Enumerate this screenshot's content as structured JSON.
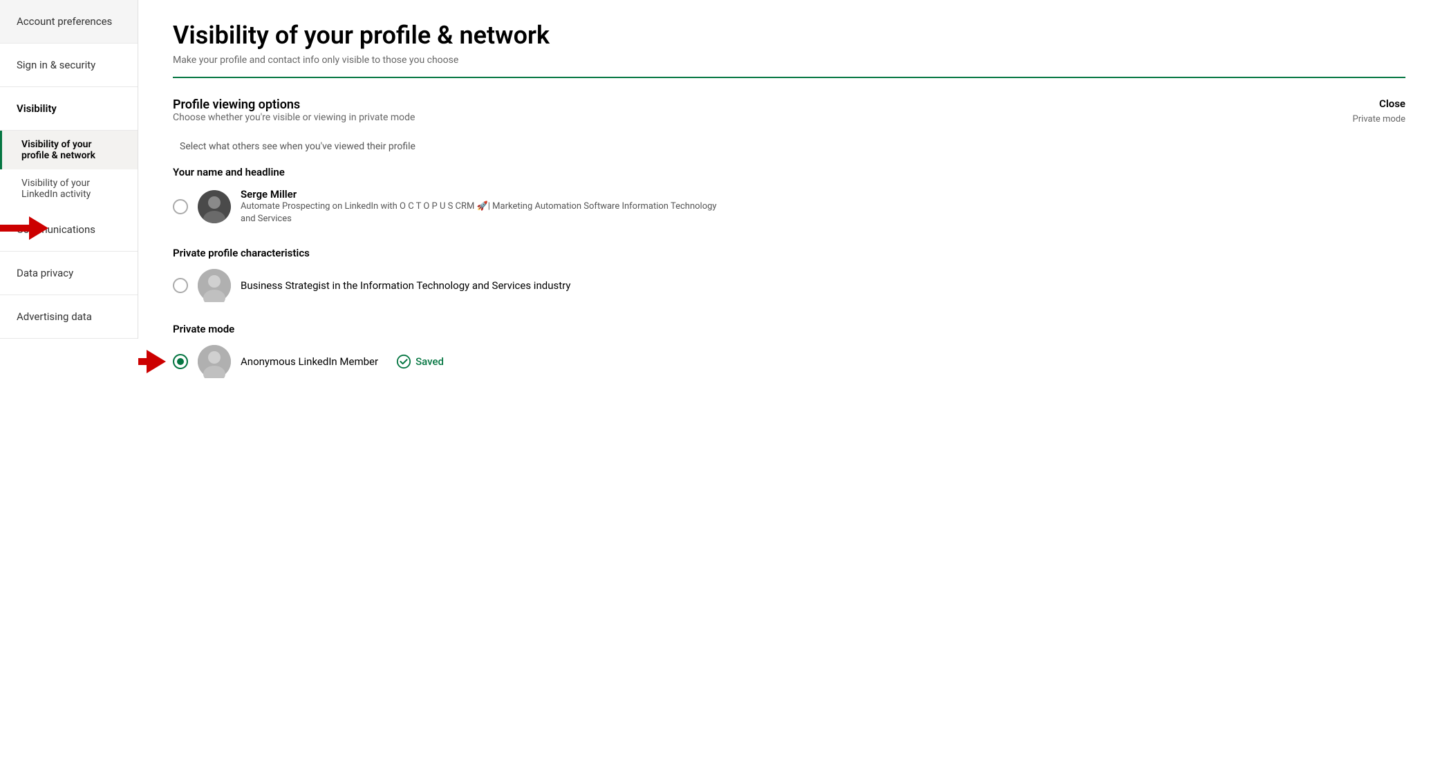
{
  "sidebar": {
    "items": [
      {
        "id": "account-preferences",
        "label": "Account preferences",
        "active": false
      },
      {
        "id": "sign-in-security",
        "label": "Sign in & security",
        "active": false
      },
      {
        "id": "visibility",
        "label": "Visibility",
        "active": true,
        "subitems": [
          {
            "id": "visibility-profile-network",
            "label": "Visibility of your profile & network",
            "active": true
          },
          {
            "id": "visibility-linkedin-activity",
            "label": "Visibility of your LinkedIn activity",
            "active": false
          }
        ]
      },
      {
        "id": "communications",
        "label": "Communications",
        "active": false
      },
      {
        "id": "data-privacy",
        "label": "Data privacy",
        "active": false
      },
      {
        "id": "advertising-data",
        "label": "Advertising data",
        "active": false
      }
    ]
  },
  "main": {
    "page_title": "Visibility of your profile & network",
    "page_subtitle": "Make your profile and contact info only visible to those you choose",
    "section_title": "Profile viewing options",
    "section_subtitle": "Choose whether you're visible or viewing in private mode",
    "select_hint": "Select what others see when you've viewed their profile",
    "close_label": "Close",
    "close_subtext": "Private mode",
    "options": [
      {
        "id": "your-name",
        "group_label": "Your name and headline",
        "name": "Serge Miller",
        "desc": "Automate Prospecting on LinkedIn with O C T O P U S CRM 🚀| Marketing Automation Software Information Technology and Services",
        "selected": false,
        "has_avatar": true,
        "avatar_type": "photo"
      },
      {
        "id": "private-characteristics",
        "group_label": "Private profile characteristics",
        "name": "",
        "desc": "Business Strategist in the Information Technology and Services industry",
        "selected": false,
        "has_avatar": true,
        "avatar_type": "placeholder"
      },
      {
        "id": "private-mode",
        "group_label": "Private mode",
        "name": "Anonymous LinkedIn Member",
        "desc": "",
        "selected": true,
        "has_avatar": true,
        "avatar_type": "placeholder",
        "saved": true,
        "saved_label": "Saved"
      }
    ]
  }
}
